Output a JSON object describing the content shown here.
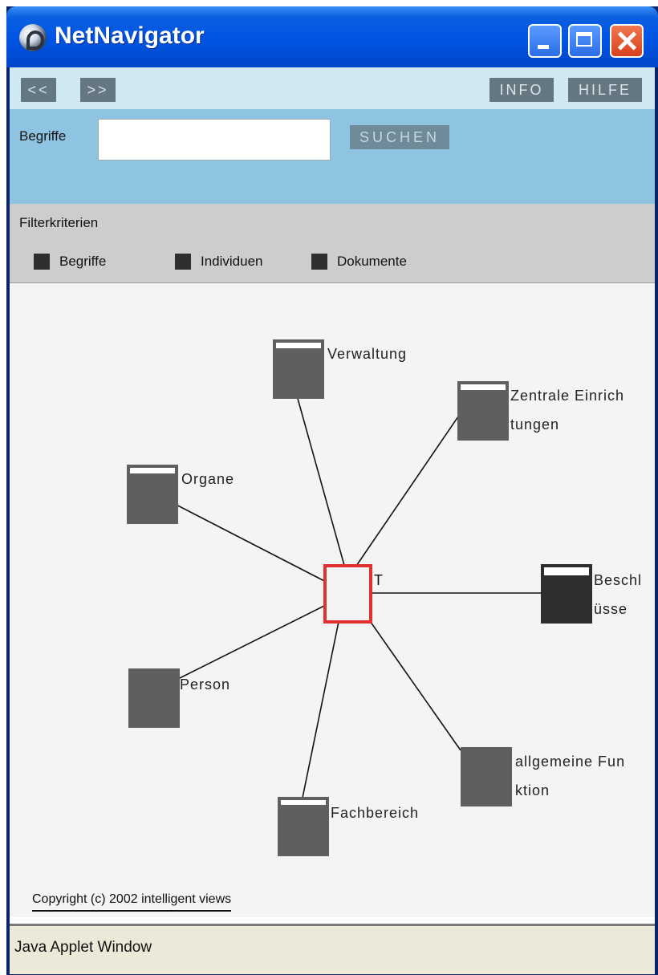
{
  "window": {
    "title": "NetNavigator",
    "icons": {
      "app": "netnavigator-app-icon",
      "minimize": "minimize-icon",
      "maximize": "maximize-icon",
      "close": "close-icon"
    }
  },
  "toolbar": {
    "back_label": "<<",
    "forward_label": ">>",
    "info_label": "INFO",
    "help_label": "HILFE"
  },
  "search": {
    "label": "Begriffe",
    "value": "",
    "placeholder": "",
    "button_label": "SUCHEN"
  },
  "filters": {
    "title": "Filterkriterien",
    "options": [
      {
        "label": "Begriffe",
        "checked": true
      },
      {
        "label": "Individuen",
        "checked": true
      },
      {
        "label": "Dokumente",
        "checked": true
      }
    ]
  },
  "graph": {
    "center": {
      "label": "T",
      "color": "#e03030"
    },
    "nodes": [
      {
        "id": "verwaltung",
        "lines": [
          "Verwaltung"
        ]
      },
      {
        "id": "zentrale",
        "lines": [
          "Zentrale Einrich",
          "tungen"
        ]
      },
      {
        "id": "organe",
        "lines": [
          "Organe"
        ]
      },
      {
        "id": "beschluesse",
        "lines": [
          "Beschl",
          "üsse"
        ]
      },
      {
        "id": "person",
        "lines": [
          "Person"
        ]
      },
      {
        "id": "allgemeine",
        "lines": [
          "allgemeine Fun",
          "ktion"
        ]
      },
      {
        "id": "fachbereich",
        "lines": [
          "Fachbereich"
        ]
      }
    ],
    "colors": {
      "node": "#5f5f5f",
      "node_selected": "#2e2e2e",
      "edge": "#111111"
    }
  },
  "footer": {
    "copyright": "Copyright (c) 2002 intelligent views"
  },
  "status": {
    "text": "Java Applet Window"
  }
}
